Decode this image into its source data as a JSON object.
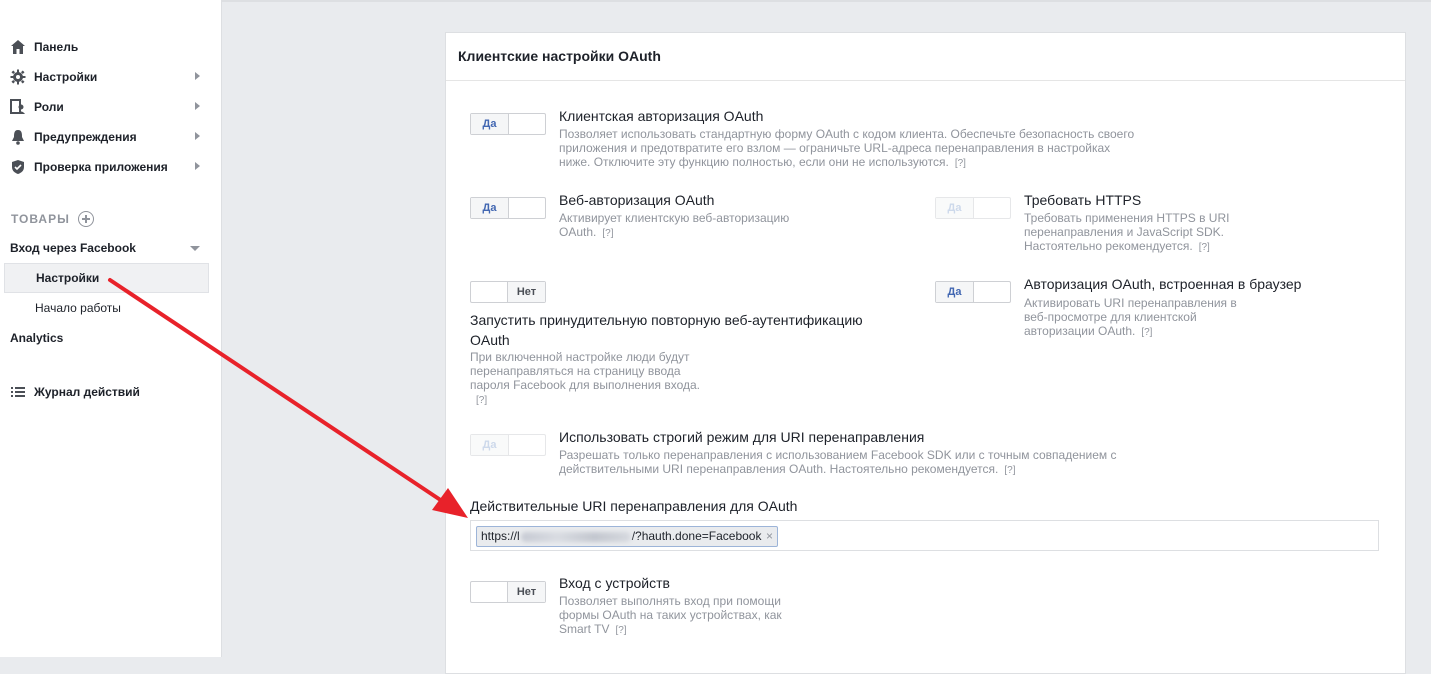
{
  "sidebar": {
    "items": [
      {
        "label": "Панель",
        "icon": "home-icon"
      },
      {
        "label": "Настройки",
        "icon": "gear-icon"
      },
      {
        "label": "Роли",
        "icon": "roles-icon"
      },
      {
        "label": "Предупреждения",
        "icon": "bell-icon"
      },
      {
        "label": "Проверка приложения",
        "icon": "shield-icon"
      }
    ],
    "section_title": "ТОВАРЫ",
    "product": "Вход через Facebook",
    "product_subitems": [
      "Настройки",
      "Начало работы"
    ],
    "analytics": "Analytics",
    "activity_log": "Журнал действий"
  },
  "card": {
    "title": "Клиентские настройки OAuth"
  },
  "settings": {
    "client_oauth": {
      "toggle": "Да",
      "title": "Клиентская авторизация OAuth",
      "desc": [
        "Позволяет использовать стандартную форму OAuth с кодом клиента. Обеспечьте безопасность своего",
        "приложения и предотвратите его взлом — ограничьте URL-адреса перенаправления в настройках",
        "ниже. Отключите эту функцию полностью, если они не используются."
      ],
      "help": "[?]"
    },
    "web_oauth": {
      "toggle": "Да",
      "title": "Веб-авторизация OAuth",
      "desc": [
        "Активирует клиентскую веб-авторизацию",
        "OAuth."
      ],
      "help": "[?]"
    },
    "https": {
      "toggle": "Да",
      "title": "Требовать HTTPS",
      "desc": [
        "Требовать применения HTTPS в URI",
        "перенаправления и JavaScript SDK.",
        "Настоятельно рекомендуется."
      ],
      "help": "[?]"
    },
    "reauth": {
      "toggle": "Нет",
      "title": [
        "Запустить принудительную повторную веб-аутентификацию",
        "OAuth"
      ],
      "desc": [
        "При включенной настройке люди будут",
        "перенаправляться на страницу ввода",
        "пароля Facebook для выполнения входа."
      ],
      "help": "[?]"
    },
    "embedded": {
      "toggle": "Да",
      "title": "Авторизация OAuth, встроенная в браузер",
      "desc": [
        "Активировать URI перенаправления в",
        "веб-просмотре для клиентской",
        "авторизации OAuth."
      ],
      "help": "[?]"
    },
    "strict": {
      "toggle": "Да",
      "title": "Использовать строгий режим для URI перенаправления",
      "desc": [
        "Разрешать только перенаправления с использованием Facebook SDK или с точным совпадением с",
        "действительными URI перенаправления OAuth. Настоятельно рекомендуется."
      ],
      "help": "[?]"
    },
    "device": {
      "toggle": "Нет",
      "title": "Вход с устройств",
      "desc": [
        "Позволяет выполнять вход при помощи",
        "формы OAuth на таких устройствах, как",
        "Smart TV"
      ],
      "help": "[?]"
    }
  },
  "redirect_uris": {
    "label": "Действительные URI перенаправления для OAuth",
    "token_prefix": "https://l",
    "token_suffix": "/?hauth.done=Facebook",
    "remove": "×"
  },
  "colors": {
    "accent": "#4267b2",
    "arrow": "#e8222a",
    "muted": "#90949c"
  }
}
